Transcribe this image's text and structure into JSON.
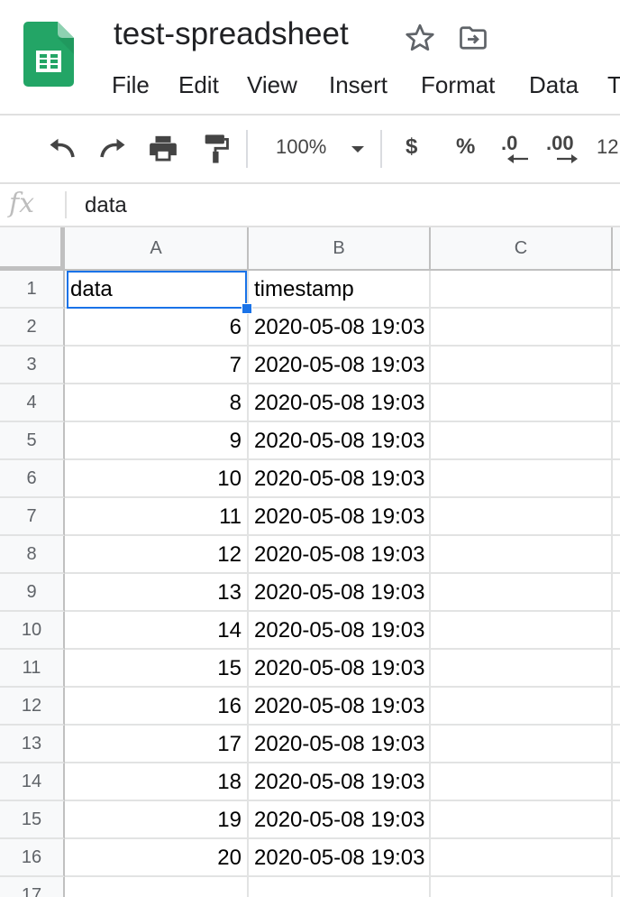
{
  "app": {
    "doc_title": "test-spreadsheet"
  },
  "menu": {
    "items": [
      "File",
      "Edit",
      "View",
      "Insert",
      "Format",
      "Data",
      "T"
    ]
  },
  "toolbar": {
    "zoom": "100%",
    "currency_label": "$",
    "percent_label": "%",
    "decrease_decimal_label": ".0",
    "increase_decimal_label": ".00",
    "more_formats_label": "12"
  },
  "formula_bar": {
    "fx_label": "fx",
    "value": "data"
  },
  "sheet": {
    "columns": [
      "A",
      "B",
      "C"
    ],
    "rows": [
      {
        "row": "1",
        "a": "data",
        "b": "timestamp",
        "c": ""
      },
      {
        "row": "2",
        "a": "6",
        "b": "2020-05-08 19:03",
        "c": ""
      },
      {
        "row": "3",
        "a": "7",
        "b": "2020-05-08 19:03",
        "c": ""
      },
      {
        "row": "4",
        "a": "8",
        "b": "2020-05-08 19:03",
        "c": ""
      },
      {
        "row": "5",
        "a": "9",
        "b": "2020-05-08 19:03",
        "c": ""
      },
      {
        "row": "6",
        "a": "10",
        "b": "2020-05-08 19:03",
        "c": ""
      },
      {
        "row": "7",
        "a": "11",
        "b": "2020-05-08 19:03",
        "c": ""
      },
      {
        "row": "8",
        "a": "12",
        "b": "2020-05-08 19:03",
        "c": ""
      },
      {
        "row": "9",
        "a": "13",
        "b": "2020-05-08 19:03",
        "c": ""
      },
      {
        "row": "10",
        "a": "14",
        "b": "2020-05-08 19:03",
        "c": ""
      },
      {
        "row": "11",
        "a": "15",
        "b": "2020-05-08 19:03",
        "c": ""
      },
      {
        "row": "12",
        "a": "16",
        "b": "2020-05-08 19:03",
        "c": ""
      },
      {
        "row": "13",
        "a": "17",
        "b": "2020-05-08 19:03",
        "c": ""
      },
      {
        "row": "14",
        "a": "18",
        "b": "2020-05-08 19:03",
        "c": ""
      },
      {
        "row": "15",
        "a": "19",
        "b": "2020-05-08 19:03",
        "c": ""
      },
      {
        "row": "16",
        "a": "20",
        "b": "2020-05-08 19:03",
        "c": ""
      },
      {
        "row": "17",
        "a": "",
        "b": "",
        "c": ""
      }
    ],
    "selected_cell": "A1"
  },
  "colors": {
    "selection": "#1a73e8",
    "logo_green": "#23a566"
  }
}
